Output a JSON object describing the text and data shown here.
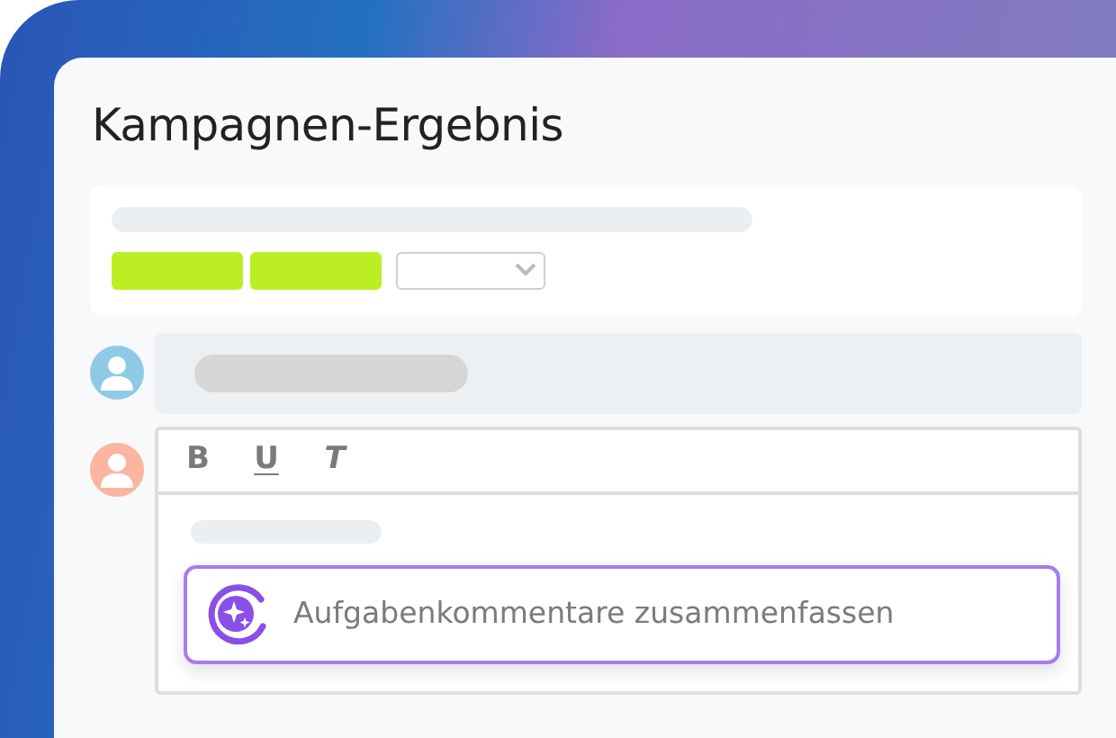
{
  "title": "Kampagnen-Ergebnis",
  "comments": [
    {
      "color": "#8ecae6"
    },
    {
      "color": "#fbb5a0"
    }
  ],
  "toolbar": [
    {
      "label": "B",
      "kind": "bold"
    },
    {
      "label": "U",
      "kind": "underline"
    },
    {
      "label": "T",
      "kind": "italic"
    }
  ],
  "suggestion": "Aufgabenkommentare zusammenfassen"
}
